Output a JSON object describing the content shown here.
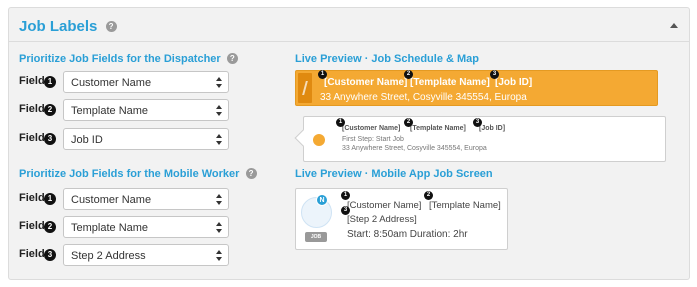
{
  "panel": {
    "title": "Job Labels",
    "help_icon": "?",
    "collapse_icon": "chevron-up-icon"
  },
  "dispatcher": {
    "title": "Prioritize Job Fields for the Dispatcher",
    "fields": [
      {
        "label": "Field",
        "number": "1",
        "value": "Customer Name"
      },
      {
        "label": "Field",
        "number": "2",
        "value": "Template Name"
      },
      {
        "label": "Field",
        "number": "3",
        "value": "Job ID"
      }
    ]
  },
  "mobile": {
    "title": "Prioritize Job Fields for the Mobile Worker",
    "fields": [
      {
        "label": "Field",
        "number": "1",
        "value": "Customer Name"
      },
      {
        "label": "Field",
        "number": "2",
        "value": "Template Name"
      },
      {
        "label": "Field",
        "number": "3",
        "value": "Step 2 Address"
      }
    ]
  },
  "schedule_preview": {
    "title": "Live Preview · Job Schedule & Map",
    "active": {
      "tag1": "[Customer Name]",
      "tag2": "[Template Name]",
      "tag3": "[Job ID]",
      "badge1": "1",
      "badge2": "2",
      "badge3": "3",
      "address": "33 Anywhere Street, Cosyville 345554, Europa"
    },
    "card": {
      "tag1": "[Customer Name]",
      "tag2": "[Template Name]",
      "tag3": "[Job ID]",
      "badge1": "1",
      "badge2": "2",
      "badge3": "3",
      "step": "First Step: Start Job",
      "address": "33 Anywhere Street, Cosyville 345554, Europa"
    },
    "colors": {
      "accent": "#f4a933",
      "link": "#2a9fd6"
    }
  },
  "mobile_preview": {
    "title": "Live Preview · Mobile App Job Screen",
    "avatar_letter": "N",
    "job_tag": "JOB",
    "tag1": "[Customer Name]",
    "tag2": "[Template Name]",
    "tag3": "[Step 2 Address]",
    "badge1": "1",
    "badge2": "2",
    "badge3": "3",
    "times": "Start: 8:50am Duration: 2hr"
  }
}
